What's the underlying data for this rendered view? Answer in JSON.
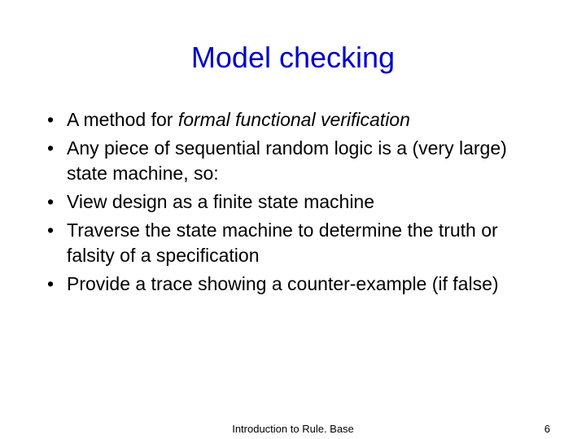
{
  "title": "Model checking",
  "bullets": [
    {
      "prefix": "A method for ",
      "italic": "formal functional verification",
      "suffix": ""
    },
    {
      "prefix": "Any piece of sequential random logic is a (very large) state machine, so:",
      "italic": "",
      "suffix": ""
    },
    {
      "prefix": "View design as a finite state machine",
      "italic": "",
      "suffix": ""
    },
    {
      "prefix": "Traverse the state machine to determine the truth or falsity of a specification",
      "italic": "",
      "suffix": ""
    },
    {
      "prefix": "Provide a trace showing a counter-example (if false)",
      "italic": "",
      "suffix": ""
    }
  ],
  "footer_center": "Introduction to Rule. Base",
  "footer_right": "6"
}
